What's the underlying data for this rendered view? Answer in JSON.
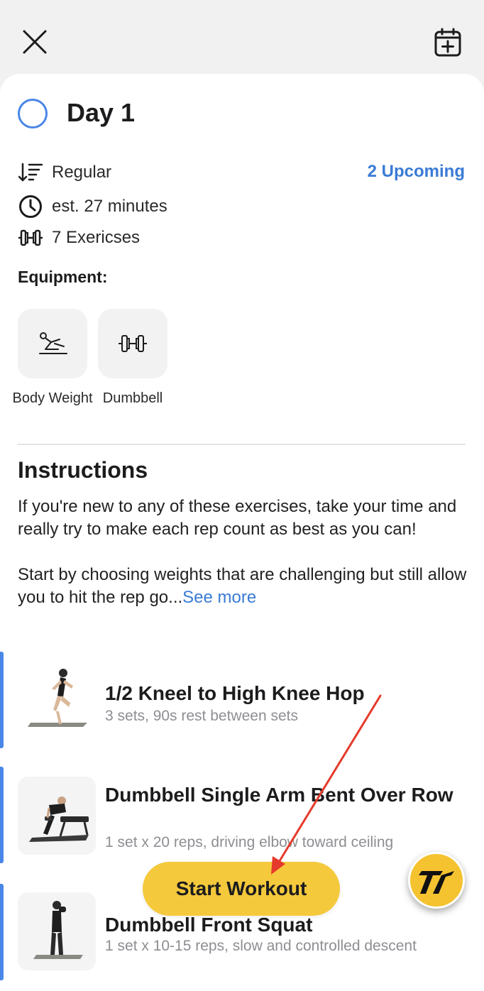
{
  "header": {
    "close_icon": "close-icon",
    "calendar_icon": "calendar-add-icon"
  },
  "workout": {
    "title": "Day 1",
    "type_label": "Regular",
    "upcoming_link": "2 Upcoming",
    "duration": "est. 27 minutes",
    "exercise_count": "7 Exericses"
  },
  "equipment": {
    "heading": "Equipment:",
    "items": [
      {
        "label": "Body Weight",
        "icon": "body-weight-icon"
      },
      {
        "label": "Dumbbell",
        "icon": "dumbbell-icon"
      }
    ]
  },
  "instructions": {
    "heading": "Instructions",
    "paragraph1": "If you're new to any of these exercises, take your time and really try to make each rep count as best as you can!",
    "paragraph2": "Start by choosing weights that are challenging but still allow you to hit the rep go...",
    "see_more": "See more"
  },
  "exercises": [
    {
      "name": "1/2 Kneel to High Knee Hop",
      "detail": "3 sets, 90s rest between sets"
    },
    {
      "name": "Dumbbell Single Arm Bent Over Row",
      "detail": "1 set x 20 reps, driving elbow toward ceiling"
    },
    {
      "name": "Dumbbell Front Squat",
      "detail": "1 set x 10-15 reps, slow and controlled descent"
    }
  ],
  "actions": {
    "start_label": "Start Workout"
  },
  "colors": {
    "accent_blue": "#3a7bd5",
    "button_yellow": "#f5c93c",
    "annotation_red": "#e53a2b"
  }
}
